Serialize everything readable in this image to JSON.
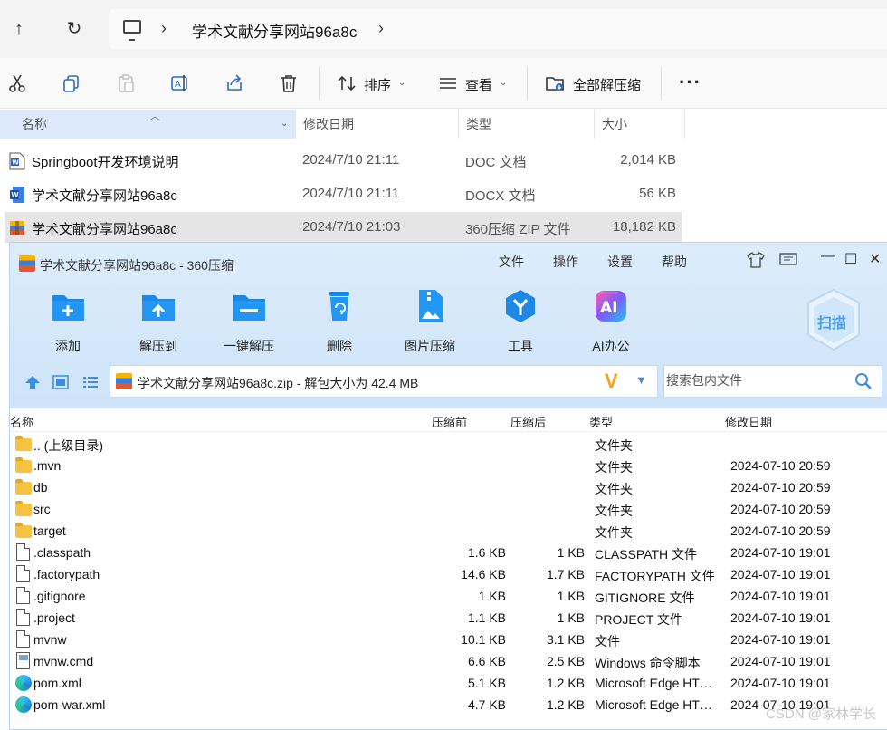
{
  "explorer": {
    "breadcrumb": "学术文献分享网站96a8c",
    "toolbar": {
      "sort_label": "排序",
      "view_label": "查看",
      "extract_all_label": "全部解压缩"
    },
    "columns": {
      "name": "名称",
      "modified": "修改日期",
      "type": "类型",
      "size": "大小"
    },
    "files": [
      {
        "name": "Springboot开发环境说明",
        "date": "2024/7/10 21:11",
        "type": "DOC 文档",
        "size": "2,014 KB",
        "icon": "word-doc-icon"
      },
      {
        "name": "学术文献分享网站96a8c",
        "date": "2024/7/10 21:11",
        "type": "DOCX 文档",
        "size": "56 KB",
        "icon": "word-docx-icon"
      },
      {
        "name": "学术文献分享网站96a8c",
        "date": "2024/7/10 21:03",
        "type": "360压缩 ZIP 文件",
        "size": "18,182 KB",
        "icon": "zip-archive-icon"
      }
    ]
  },
  "zip": {
    "title": "学术文献分享网站96a8c - 360压缩",
    "menu": {
      "file": "文件",
      "ops": "操作",
      "settings": "设置",
      "help": "帮助"
    },
    "tools": {
      "add": "添加",
      "extract_to": "解压到",
      "one_click": "一键解压",
      "delete": "删除",
      "image_compress": "图片压缩",
      "tools": "工具",
      "ai": "AI办公"
    },
    "scan_label": "扫描",
    "path": "学术文献分享网站96a8c.zip - 解包大小为 42.4 MB",
    "search_placeholder": "搜索包内文件",
    "columns": {
      "name": "名称",
      "before": "压缩前",
      "after": "压缩后",
      "type": "类型",
      "modified": "修改日期"
    },
    "rows": [
      {
        "name": ".. (上级目录)",
        "before": "",
        "after": "",
        "type": "文件夹",
        "date": "",
        "icon": "folder"
      },
      {
        "name": ".mvn",
        "before": "",
        "after": "",
        "type": "文件夹",
        "date": "2024-07-10 20:59",
        "icon": "folder"
      },
      {
        "name": "db",
        "before": "",
        "after": "",
        "type": "文件夹",
        "date": "2024-07-10 20:59",
        "icon": "folder"
      },
      {
        "name": "src",
        "before": "",
        "after": "",
        "type": "文件夹",
        "date": "2024-07-10 20:59",
        "icon": "folder"
      },
      {
        "name": "target",
        "before": "",
        "after": "",
        "type": "文件夹",
        "date": "2024-07-10 20:59",
        "icon": "folder"
      },
      {
        "name": ".classpath",
        "before": "1.6 KB",
        "after": "1 KB",
        "type": "CLASSPATH 文件",
        "date": "2024-07-10 19:01",
        "icon": "doc"
      },
      {
        "name": ".factorypath",
        "before": "14.6 KB",
        "after": "1.7 KB",
        "type": "FACTORYPATH 文件",
        "date": "2024-07-10 19:01",
        "icon": "doc"
      },
      {
        "name": ".gitignore",
        "before": "1 KB",
        "after": "1 KB",
        "type": "GITIGNORE 文件",
        "date": "2024-07-10 19:01",
        "icon": "doc"
      },
      {
        "name": ".project",
        "before": "1.1 KB",
        "after": "1 KB",
        "type": "PROJECT 文件",
        "date": "2024-07-10 19:01",
        "icon": "doc"
      },
      {
        "name": "mvnw",
        "before": "10.1 KB",
        "after": "3.1 KB",
        "type": "文件",
        "date": "2024-07-10 19:01",
        "icon": "doc"
      },
      {
        "name": "mvnw.cmd",
        "before": "6.6 KB",
        "after": "2.5 KB",
        "type": "Windows 命令脚本",
        "date": "2024-07-10 19:01",
        "icon": "cmd"
      },
      {
        "name": "pom.xml",
        "before": "5.1 KB",
        "after": "1.2 KB",
        "type": "Microsoft Edge HT…",
        "date": "2024-07-10 19:01",
        "icon": "edge"
      },
      {
        "name": "pom-war.xml",
        "before": "4.7 KB",
        "after": "1.2 KB",
        "type": "Microsoft Edge HT…",
        "date": "2024-07-10 19:01",
        "icon": "edge"
      }
    ]
  },
  "watermark": "CSDN @家林学长"
}
